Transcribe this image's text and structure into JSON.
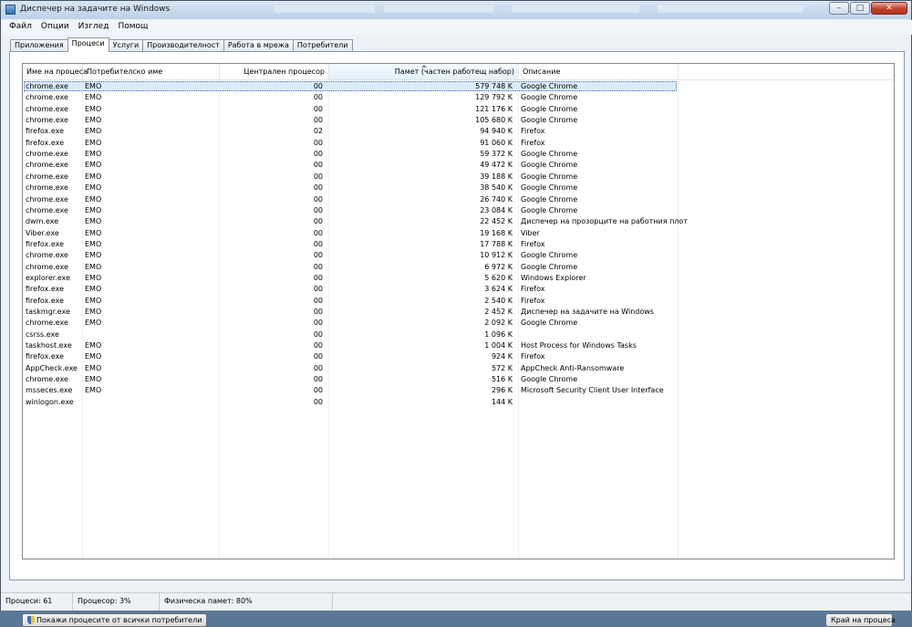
{
  "window": {
    "title": "Диспечер на задачите на Windows",
    "buttons": {
      "minimize": "–",
      "maximize": "□",
      "close": "✕"
    }
  },
  "menu": [
    "Файл",
    "Опции",
    "Изглед",
    "Помощ"
  ],
  "tabs": [
    "Приложения",
    "Процеси",
    "Услуги",
    "Производителност",
    "Работа в мрежа",
    "Потребители"
  ],
  "active_tab": 1,
  "columns": {
    "name": "Име на процеса",
    "user": "Потребителско име",
    "cpu": "Централен процесор",
    "memory": "Памет (частен работещ набор)",
    "description": "Описание"
  },
  "rows": [
    {
      "name": "chrome.exe",
      "user": "EMO",
      "cpu": "00",
      "mem": "579 748 K",
      "desc": "Google Chrome"
    },
    {
      "name": "chrome.exe",
      "user": "EMO",
      "cpu": "00",
      "mem": "129 792 K",
      "desc": "Google Chrome"
    },
    {
      "name": "chrome.exe",
      "user": "EMO",
      "cpu": "00",
      "mem": "121 176 K",
      "desc": "Google Chrome"
    },
    {
      "name": "chrome.exe",
      "user": "EMO",
      "cpu": "00",
      "mem": "105 680 K",
      "desc": "Google Chrome"
    },
    {
      "name": "firefox.exe",
      "user": "EMO",
      "cpu": "02",
      "mem": "94 940 K",
      "desc": "Firefox"
    },
    {
      "name": "firefox.exe",
      "user": "EMO",
      "cpu": "00",
      "mem": "91 060 K",
      "desc": "Firefox"
    },
    {
      "name": "chrome.exe",
      "user": "EMO",
      "cpu": "00",
      "mem": "59 372 K",
      "desc": "Google Chrome"
    },
    {
      "name": "chrome.exe",
      "user": "EMO",
      "cpu": "00",
      "mem": "49 472 K",
      "desc": "Google Chrome"
    },
    {
      "name": "chrome.exe",
      "user": "EMO",
      "cpu": "00",
      "mem": "39 188 K",
      "desc": "Google Chrome"
    },
    {
      "name": "chrome.exe",
      "user": "EMO",
      "cpu": "00",
      "mem": "38 540 K",
      "desc": "Google Chrome"
    },
    {
      "name": "chrome.exe",
      "user": "EMO",
      "cpu": "00",
      "mem": "26 740 K",
      "desc": "Google Chrome"
    },
    {
      "name": "chrome.exe",
      "user": "EMO",
      "cpu": "00",
      "mem": "23 084 K",
      "desc": "Google Chrome"
    },
    {
      "name": "dwm.exe",
      "user": "EMO",
      "cpu": "00",
      "mem": "22 452 K",
      "desc": "Диспечер на прозорците на работния плот"
    },
    {
      "name": "Viber.exe",
      "user": "EMO",
      "cpu": "00",
      "mem": "19 168 K",
      "desc": "Viber"
    },
    {
      "name": "firefox.exe",
      "user": "EMO",
      "cpu": "00",
      "mem": "17 788 K",
      "desc": "Firefox"
    },
    {
      "name": "chrome.exe",
      "user": "EMO",
      "cpu": "00",
      "mem": "10 912 K",
      "desc": "Google Chrome"
    },
    {
      "name": "chrome.exe",
      "user": "EMO",
      "cpu": "00",
      "mem": "6 972 K",
      "desc": "Google Chrome"
    },
    {
      "name": "explorer.exe",
      "user": "EMO",
      "cpu": "00",
      "mem": "5 620 K",
      "desc": "Windows Explorer"
    },
    {
      "name": "firefox.exe",
      "user": "EMO",
      "cpu": "00",
      "mem": "3 624 K",
      "desc": "Firefox"
    },
    {
      "name": "firefox.exe",
      "user": "EMO",
      "cpu": "00",
      "mem": "2 540 K",
      "desc": "Firefox"
    },
    {
      "name": "taskmgr.exe",
      "user": "EMO",
      "cpu": "00",
      "mem": "2 452 K",
      "desc": "Диспечер на задачите на Windows"
    },
    {
      "name": "chrome.exe",
      "user": "EMO",
      "cpu": "00",
      "mem": "2 092 K",
      "desc": "Google Chrome"
    },
    {
      "name": "csrss.exe",
      "user": "",
      "cpu": "00",
      "mem": "1 096 K",
      "desc": ""
    },
    {
      "name": "taskhost.exe",
      "user": "EMO",
      "cpu": "00",
      "mem": "1 004 K",
      "desc": "Host Process for Windows Tasks"
    },
    {
      "name": "firefox.exe",
      "user": "EMO",
      "cpu": "00",
      "mem": "924 K",
      "desc": "Firefox"
    },
    {
      "name": "AppCheck.exe",
      "user": "EMO",
      "cpu": "00",
      "mem": "572 K",
      "desc": "AppCheck Anti-Ransomware"
    },
    {
      "name": "chrome.exe",
      "user": "EMO",
      "cpu": "00",
      "mem": "516 K",
      "desc": "Google Chrome"
    },
    {
      "name": "msseces.exe",
      "user": "EMO",
      "cpu": "00",
      "mem": "296 K",
      "desc": "Microsoft Security Client User Interface"
    },
    {
      "name": "winlogon.exe",
      "user": "",
      "cpu": "00",
      "mem": "144 K",
      "desc": ""
    }
  ],
  "selected_row": 0,
  "buttons": {
    "show_all": "Покажи процесите от всички потребители",
    "end_process": "Край на процеса"
  },
  "status": {
    "processes": "Процеси: 61",
    "cpu": "Процесор: 3%",
    "memory": "Физическа памет: 80%"
  }
}
